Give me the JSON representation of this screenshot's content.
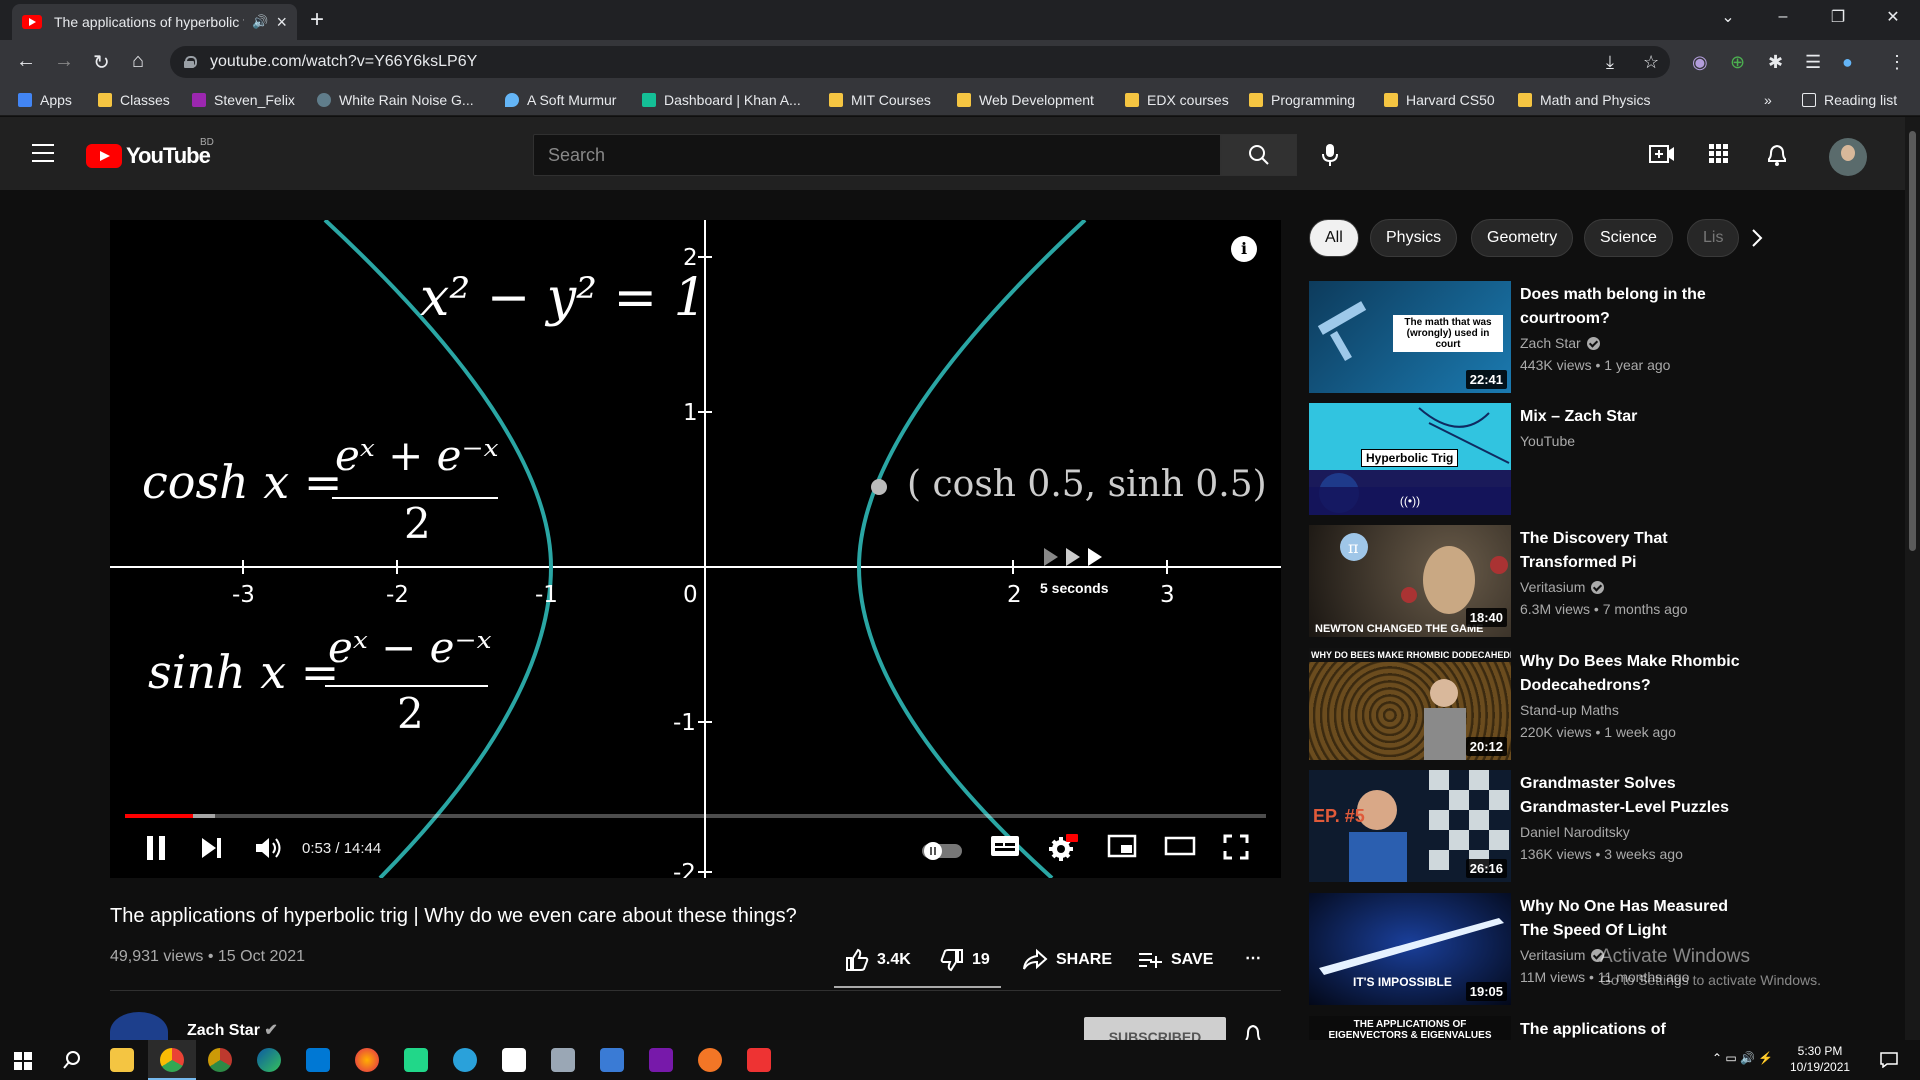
{
  "browser": {
    "tab_title": "The applications of hyperbolic trig | Why do we even care about these things? - YouTube",
    "url": "youtube.com/watch?v=Y66Y6ksLP6Y",
    "bookmarks": [
      {
        "label": "Apps",
        "color": "#4285f4"
      },
      {
        "label": "Classes",
        "color": "#f5c542"
      },
      {
        "label": "Steven_Felix",
        "color": "#9c27b0"
      },
      {
        "label": "White Rain Noise G...",
        "color": "#607d8b"
      },
      {
        "label": "A Soft Murmur",
        "color": "#64b5f6"
      },
      {
        "label": "Dashboard | Khan A...",
        "color": "#14bf96"
      },
      {
        "label": "MIT Courses",
        "color": "#f5c542"
      },
      {
        "label": "Web Development",
        "color": "#f5c542"
      },
      {
        "label": "EDX courses",
        "color": "#f5c542"
      },
      {
        "label": "Programming",
        "color": "#f5c542"
      },
      {
        "label": "Harvard CS50",
        "color": "#f5c542"
      },
      {
        "label": "Math and Physics",
        "color": "#f5c542"
      }
    ],
    "more": "»",
    "reading_list": "Reading list"
  },
  "youtube": {
    "logo_text": "YouTube",
    "country": "BD",
    "search_placeholder": "Search"
  },
  "video": {
    "equation_top": "x² − y² = 1",
    "cosh_lhs": "cosh x =",
    "cosh_num": "eˣ + e⁻ˣ",
    "sinh_lhs": "sinh x =",
    "sinh_num": "eˣ − e⁻ˣ",
    "denominator": "2",
    "point_label": "( cosh 0.5, sinh 0.5)",
    "x_ticks": [
      "-3",
      "-2",
      "-1",
      "0",
      "2",
      "3"
    ],
    "y_ticks": [
      "2",
      "1",
      "-1",
      "-2"
    ],
    "skip_text": "5 seconds",
    "time": "0:53 / 14:44",
    "progress_fraction": 0.06,
    "title": "The applications of hyperbolic trig | Why do we even care about these things?",
    "meta": "49,931 views • 15 Oct 2021",
    "likes": "3.4K",
    "dislikes": "19",
    "share": "SHARE",
    "save": "SAVE",
    "channel": "Zach Star",
    "subscribe": "SUBSCRIBED"
  },
  "chips": [
    "All",
    "Physics",
    "Geometry",
    "Science",
    "Lis"
  ],
  "recommendations": [
    {
      "title": "Does math belong in the courtroom?",
      "channel": "Zach Star",
      "verified": true,
      "views": "443K views • 1 year ago",
      "duration": "22:41",
      "thumb_text": "The math that was (wrongly) used in court"
    },
    {
      "title": "Mix – Zach Star",
      "channel": "YouTube",
      "verified": false,
      "views": "",
      "duration": "",
      "thumb_text": "Hyperbolic Trig"
    },
    {
      "title": "The Discovery That Transformed Pi",
      "channel": "Veritasium",
      "verified": true,
      "views": "6.3M views • 7 months ago",
      "duration": "18:40",
      "thumb_text": "NEWTON CHANGED THE GAME"
    },
    {
      "title": "Why Do Bees Make Rhombic Dodecahedrons?",
      "channel": "Stand-up Maths",
      "verified": false,
      "views": "220K views • 1 week ago",
      "duration": "20:12",
      "thumb_text": "WHY DO BEES MAKE RHOMBIC DODECAHEDRONS?"
    },
    {
      "title": "Grandmaster Solves Grandmaster-Level Puzzles",
      "channel": "Daniel Naroditsky",
      "verified": false,
      "views": "136K views • 3 weeks ago",
      "duration": "26:16",
      "thumb_text": "EP. #5"
    },
    {
      "title": "Why No One Has Measured The Speed Of Light",
      "channel": "Veritasium",
      "verified": true,
      "views": "11M views • 11 months ago",
      "duration": "19:05",
      "thumb_text": "IT'S IMPOSSIBLE"
    },
    {
      "title": "The applications of",
      "channel": "",
      "verified": false,
      "views": "",
      "duration": "",
      "thumb_text": "THE APPLICATIONS OF EIGENVECTORS & EIGENVALUES"
    }
  ],
  "watermark": {
    "line1": "Activate Windows",
    "line2": "Go to Settings to activate Windows."
  },
  "taskbar": {
    "time": "5:30 PM",
    "date": "10/19/2021"
  }
}
